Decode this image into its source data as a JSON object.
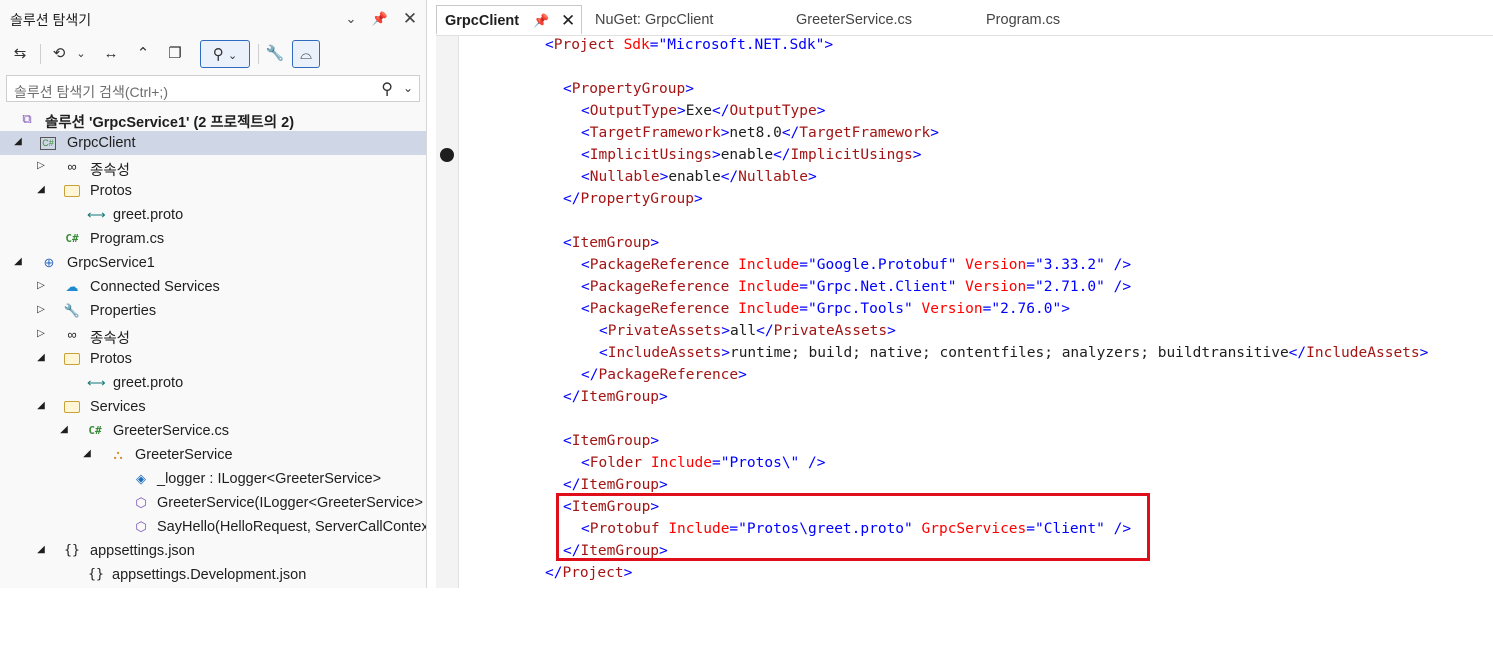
{
  "solution_explorer": {
    "title": "솔루션 탐색기",
    "search_placeholder": "솔루션 탐색기 검색(Ctrl+;)",
    "tree": [
      {
        "label": "솔루션 'GrpcService1'  (2 프로젝트의 2)",
        "icon": "solution-icon"
      },
      {
        "label": "GrpcClient",
        "icon": "project-icon",
        "selected": true
      },
      {
        "label": "종속성",
        "icon": "dependencies-icon"
      },
      {
        "label": "Protos",
        "icon": "folder-icon"
      },
      {
        "label": "greet.proto",
        "icon": "proto-file-icon"
      },
      {
        "label": "Program.cs",
        "icon": "csharp-file-icon",
        "icon_text": "C#"
      },
      {
        "label": "GrpcService1",
        "icon": "web-project-icon"
      },
      {
        "label": "Connected Services",
        "icon": "cloud-icon"
      },
      {
        "label": "Properties",
        "icon": "wrench-icon"
      },
      {
        "label": "종속성",
        "icon": "dependencies-icon"
      },
      {
        "label": "Protos",
        "icon": "folder-icon"
      },
      {
        "label": "greet.proto",
        "icon": "proto-file-icon"
      },
      {
        "label": "Services",
        "icon": "folder-icon"
      },
      {
        "label": "GreeterService.cs",
        "icon": "csharp-file-icon",
        "icon_text": "C#"
      },
      {
        "label": "GreeterService",
        "icon": "class-icon"
      },
      {
        "label": "_logger : ILogger<GreeterService>",
        "icon": "field-icon"
      },
      {
        "label": "GreeterService(ILogger<GreeterService> logger)",
        "icon": "method-icon"
      },
      {
        "label": "SayHello(HelloRequest, ServerCallContext)",
        "icon": "method-icon"
      },
      {
        "label": "appsettings.json",
        "icon": "json-file-icon",
        "icon_text": "{}"
      },
      {
        "label": "appsettings.Development.json",
        "icon": "json-file-icon",
        "icon_text": "{}"
      }
    ]
  },
  "editor": {
    "tabs": [
      {
        "label": "GrpcClient",
        "active": true
      },
      {
        "label": "NuGet: GrpcClient"
      },
      {
        "label": "GreeterService.cs"
      },
      {
        "label": "Program.cs"
      }
    ],
    "code": {
      "l0": [
        "<",
        "Project",
        " ",
        "Sdk",
        "=\"",
        "Microsoft.NET.Sdk",
        "\">"
      ],
      "l2": [
        "<",
        "PropertyGroup",
        ">"
      ],
      "l3": [
        "<",
        "OutputType",
        ">",
        "Exe",
        "</",
        "OutputType",
        ">"
      ],
      "l4": [
        "<",
        "TargetFramework",
        ">",
        "net8.0",
        "</",
        "TargetFramework",
        ">"
      ],
      "l5": [
        "<",
        "ImplicitUsings",
        ">",
        "enable",
        "</",
        "ImplicitUsings",
        ">"
      ],
      "l6": [
        "<",
        "Nullable",
        ">",
        "enable",
        "</",
        "Nullable",
        ">"
      ],
      "l7": [
        "</",
        "PropertyGroup",
        ">"
      ],
      "l9": [
        "<",
        "ItemGroup",
        ">"
      ],
      "l10": [
        "<",
        "PackageReference",
        " ",
        "Include",
        "=\"",
        "Google.Protobuf",
        "\"",
        " ",
        "Version",
        "=\"",
        "3.33.2",
        "\"",
        " />"
      ],
      "l11": [
        "<",
        "PackageReference",
        " ",
        "Include",
        "=\"",
        "Grpc.Net.Client",
        "\"",
        " ",
        "Version",
        "=\"",
        "2.71.0",
        "\"",
        " />"
      ],
      "l12": [
        "<",
        "PackageReference",
        " ",
        "Include",
        "=\"",
        "Grpc.Tools",
        "\"",
        " ",
        "Version",
        "=\"",
        "2.76.0",
        "\">"
      ],
      "l13": [
        "<",
        "PrivateAssets",
        ">",
        "all",
        "</",
        "PrivateAssets",
        ">"
      ],
      "l14": [
        "<",
        "IncludeAssets",
        ">",
        "runtime; build; native; contentfiles; analyzers; buildtransitive",
        "</",
        "IncludeAssets",
        ">"
      ],
      "l15": [
        "</",
        "PackageReference",
        ">"
      ],
      "l16": [
        "</",
        "ItemGroup",
        ">"
      ],
      "l18": [
        "<",
        "ItemGroup",
        ">"
      ],
      "l19": [
        "<",
        "Folder",
        " ",
        "Include",
        "=\"",
        "Protos\\",
        "\"",
        " />"
      ],
      "l20": [
        "</",
        "ItemGroup",
        ">"
      ],
      "l21": [
        "<",
        "ItemGroup",
        ">"
      ],
      "l22": [
        "<",
        "Protobuf",
        " ",
        "Include",
        "=\"",
        "Protos\\greet.proto",
        "\"",
        " ",
        "GrpcServices",
        "=\"",
        "Client",
        "\"",
        " />"
      ],
      "l23": [
        "</",
        "ItemGroup",
        ">"
      ],
      "l24": [
        "</",
        "Project",
        ">"
      ]
    }
  },
  "colors": {
    "highlight_box": "#e00e1a",
    "xml_delimiter": "#0000ff",
    "xml_tag": "#a31515",
    "xml_attribute": "#ff0000",
    "xml_value": "#0000ff",
    "selection": "#cfd6e5"
  }
}
